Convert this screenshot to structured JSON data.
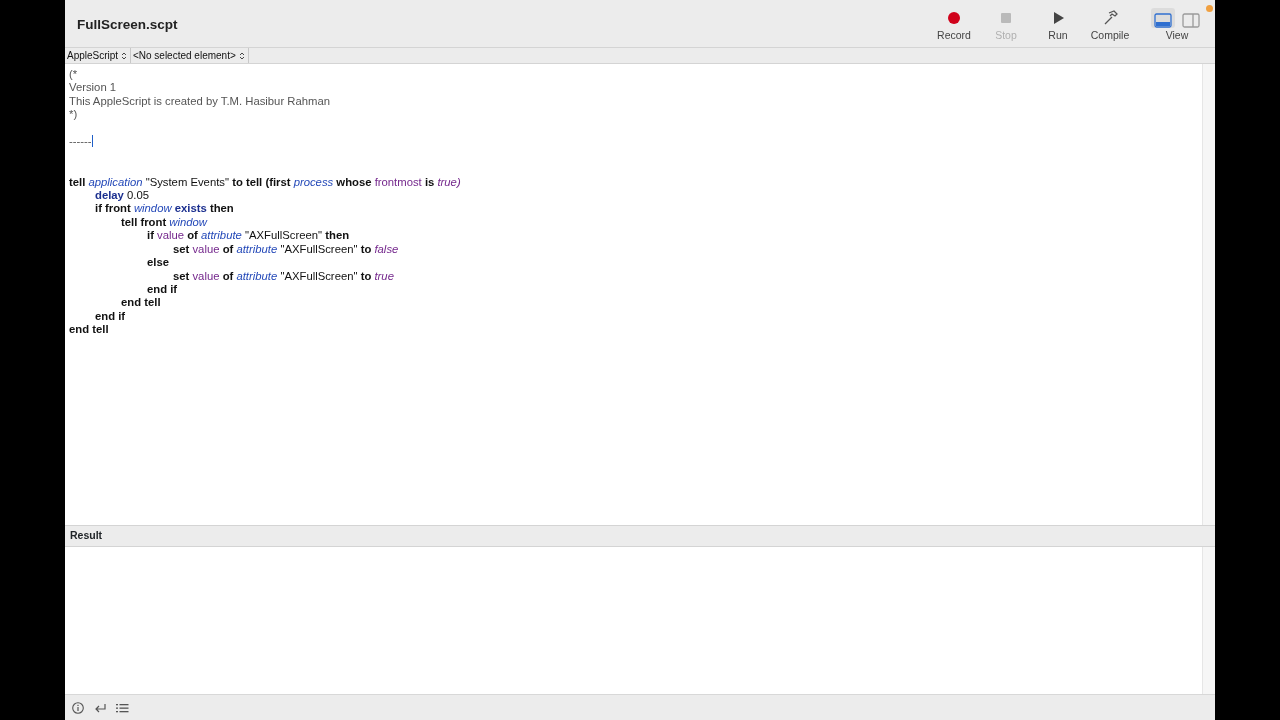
{
  "window": {
    "title": "FullScreen.scpt"
  },
  "toolbar": [
    {
      "label": "Record",
      "kind": "record",
      "disabled": false
    },
    {
      "label": "Stop",
      "kind": "stop",
      "disabled": true
    },
    {
      "label": "Run",
      "kind": "run",
      "disabled": false
    },
    {
      "label": "Compile",
      "kind": "compile",
      "disabled": false
    }
  ],
  "view": {
    "label": "View",
    "segments": [
      {
        "kind": "bottom-pane",
        "selected": true
      },
      {
        "kind": "side-pane",
        "selected": false
      }
    ]
  },
  "navigation_bar": {
    "language": "AppleScript",
    "element": "<No selected element>"
  },
  "script_lines": [
    {
      "tokens": [
        {
          "text": "(*",
          "kind": "comment"
        }
      ]
    },
    {
      "tokens": [
        {
          "text": "Version 1",
          "kind": "comment"
        }
      ]
    },
    {
      "tokens": [
        {
          "text": "This AppleScript is created by T.M. Hasibur Rahman",
          "kind": "comment"
        }
      ]
    },
    {
      "tokens": [
        {
          "text": "*)",
          "kind": "comment"
        }
      ]
    },
    {
      "kind": "blank"
    },
    {
      "tokens": [
        {
          "text": "------",
          "kind": "comment"
        }
      ],
      "cursor": true
    },
    {
      "kind": "blank"
    },
    {
      "kind": "blank"
    },
    {
      "tokens": [
        {
          "text": "tell",
          "kind": "keyword"
        },
        {
          "text": "application",
          "kind": "class"
        },
        {
          "text": "\"System Events\"",
          "kind": "string"
        },
        {
          "text": "to tell (first",
          "kind": "keyword"
        },
        {
          "text": "process",
          "kind": "class"
        },
        {
          "text": "whose",
          "kind": "keyword"
        },
        {
          "text": "frontmost",
          "kind": "property"
        },
        {
          "text": "is",
          "kind": "keyword"
        },
        {
          "text": "true)",
          "kind": "constant"
        }
      ],
      "children": [
        {
          "tokens": [
            {
              "text": "delay",
              "kind": "command"
            },
            {
              "text": "0.05",
              "kind": "string"
            }
          ]
        },
        {
          "tokens": [
            {
              "text": "if front",
              "kind": "keyword"
            },
            {
              "text": "window",
              "kind": "class"
            },
            {
              "text": "exists",
              "kind": "command"
            },
            {
              "text": "then",
              "kind": "keyword"
            }
          ],
          "children": [
            {
              "tokens": [
                {
                  "text": "tell front",
                  "kind": "keyword"
                },
                {
                  "text": "window",
                  "kind": "class"
                }
              ],
              "children": [
                {
                  "tokens": [
                    {
                      "text": "if",
                      "kind": "keyword"
                    },
                    {
                      "text": "value",
                      "kind": "property"
                    },
                    {
                      "text": "of",
                      "kind": "keyword"
                    },
                    {
                      "text": "attribute",
                      "kind": "class"
                    },
                    {
                      "text": "\"AXFullScreen\"",
                      "kind": "string"
                    },
                    {
                      "text": "then",
                      "kind": "keyword"
                    }
                  ],
                  "children": [
                    {
                      "tokens": [
                        {
                          "text": "set",
                          "kind": "keyword"
                        },
                        {
                          "text": "value",
                          "kind": "property"
                        },
                        {
                          "text": "of",
                          "kind": "keyword"
                        },
                        {
                          "text": "attribute",
                          "kind": "class"
                        },
                        {
                          "text": "\"AXFullScreen\"",
                          "kind": "string"
                        },
                        {
                          "text": "to",
                          "kind": "keyword"
                        },
                        {
                          "text": "false",
                          "kind": "constant"
                        }
                      ]
                    }
                  ]
                },
                {
                  "tokens": [
                    {
                      "text": "else",
                      "kind": "keyword"
                    }
                  ],
                  "children": [
                    {
                      "tokens": [
                        {
                          "text": "set",
                          "kind": "keyword"
                        },
                        {
                          "text": "value",
                          "kind": "property"
                        },
                        {
                          "text": "of",
                          "kind": "keyword"
                        },
                        {
                          "text": "attribute",
                          "kind": "class"
                        },
                        {
                          "text": "\"AXFullScreen\"",
                          "kind": "string"
                        },
                        {
                          "text": "to",
                          "kind": "keyword"
                        },
                        {
                          "text": "true",
                          "kind": "constant"
                        }
                      ]
                    }
                  ]
                },
                {
                  "tokens": [
                    {
                      "text": "end if",
                      "kind": "keyword"
                    }
                  ]
                }
              ]
            },
            {
              "tokens": [
                {
                  "text": "end tell",
                  "kind": "keyword"
                }
              ]
            }
          ]
        },
        {
          "tokens": [
            {
              "text": "end if",
              "kind": "keyword"
            }
          ]
        }
      ]
    },
    {
      "tokens": [
        {
          "text": "end tell",
          "kind": "keyword"
        }
      ]
    }
  ],
  "result_pane": {
    "title": "Result"
  },
  "bottom_bar": [
    {
      "kind": "info"
    },
    {
      "kind": "return"
    },
    {
      "kind": "list"
    }
  ]
}
